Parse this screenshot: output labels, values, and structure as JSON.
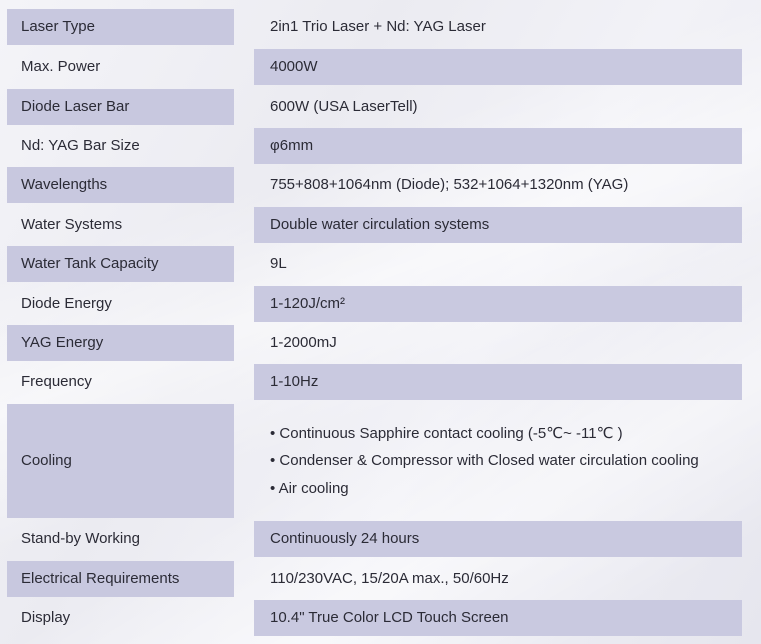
{
  "rows": [
    {
      "label": "Laser Type",
      "value": "2in1 Trio Laser + Nd: YAG Laser"
    },
    {
      "label": "Max. Power",
      "value": "4000W"
    },
    {
      "label": "Diode Laser Bar",
      "value": "600W (USA LaserTell)"
    },
    {
      "label": "Nd: YAG Bar Size",
      "value": "φ6mm"
    },
    {
      "label": "Wavelengths",
      "value": "755+808+1064nm (Diode); 532+1064+1320nm (YAG)"
    },
    {
      "label": "Water Systems",
      "value": "Double water circulation systems"
    },
    {
      "label": "Water Tank Capacity",
      "value": "9L"
    },
    {
      "label": "Diode Energy",
      "value": "1-120J/cm²"
    },
    {
      "label": "YAG Energy",
      "value": "1-2000mJ"
    },
    {
      "label": "Frequency",
      "value": "1-10Hz"
    },
    {
      "label": "Cooling",
      "bullets": [
        "• Continuous Sapphire contact cooling (-5℃~ -11℃ )",
        "• Condenser & Compressor with Closed water circulation cooling",
        "• Air cooling"
      ]
    },
    {
      "label": "Stand-by Working",
      "value": "Continuously 24 hours"
    },
    {
      "label": "Electrical Requirements",
      "value": "110/230VAC, 15/20A max.,  50/60Hz"
    },
    {
      "label": "Display",
      "value": "10.4\" True Color LCD Touch Screen"
    }
  ],
  "colors": {
    "shade": "#c8c8df",
    "background": "#efeff4",
    "text": "#2b2b36"
  }
}
